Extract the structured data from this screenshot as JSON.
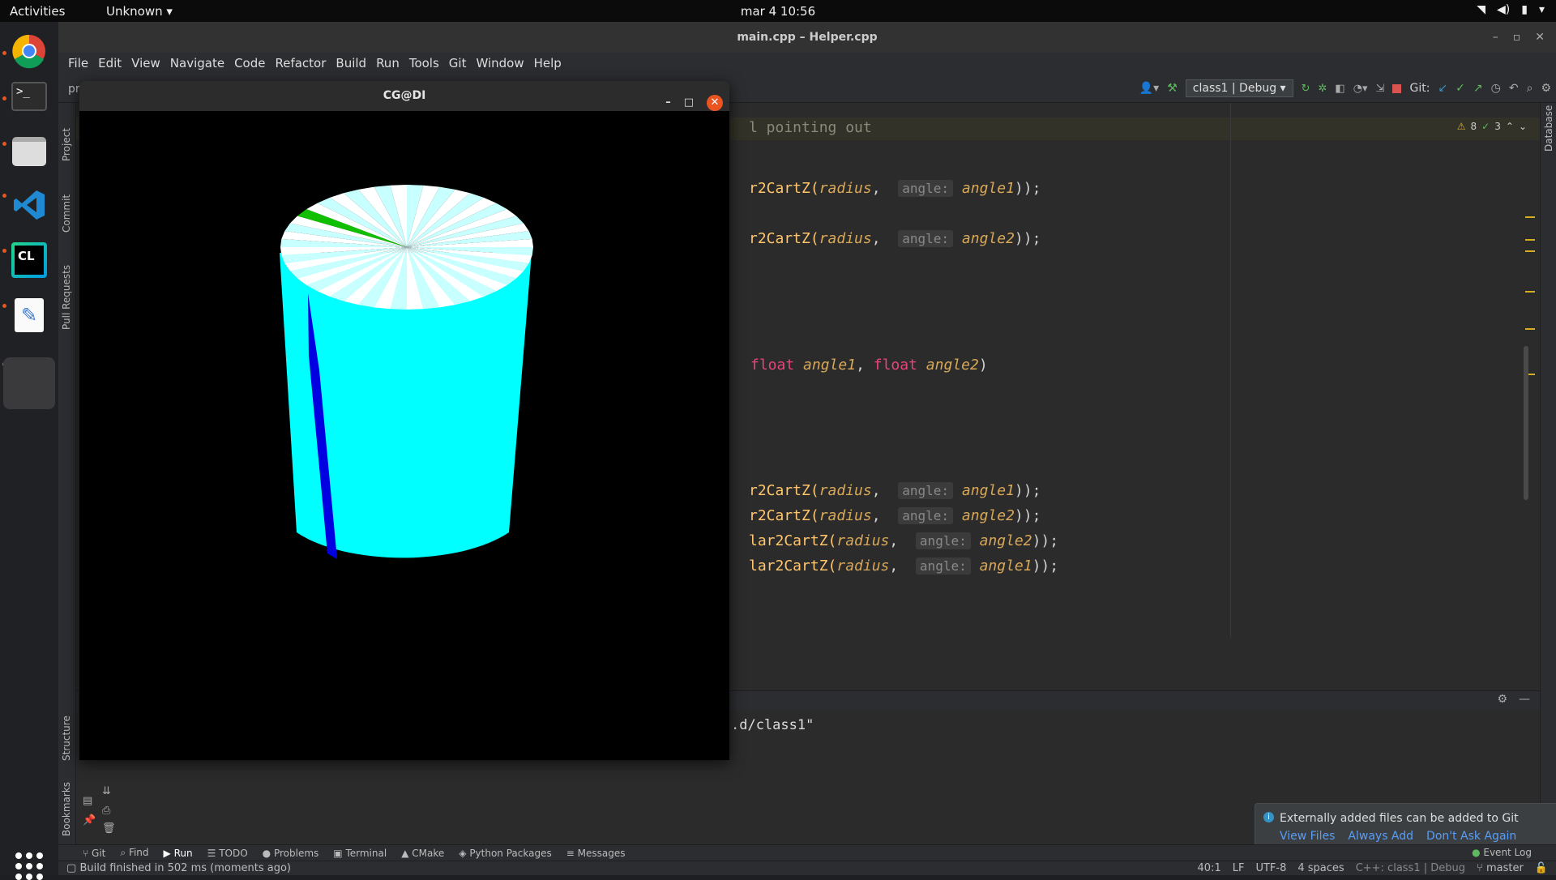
{
  "topbar": {
    "activities": "Activities",
    "app_menu": "Unknown",
    "clock": "mar 4  10:56"
  },
  "dock": {
    "items": [
      "chrome-icon",
      "terminal-icon",
      "files-icon",
      "vscode-icon",
      "clion-icon",
      "text-editor-icon",
      "running-app-icon"
    ]
  },
  "ide": {
    "title": "main.cpp – Helper.cpp",
    "menu": [
      "File",
      "Edit",
      "View",
      "Navigate",
      "Code",
      "Refactor",
      "Build",
      "Run",
      "Tools",
      "Git",
      "Window",
      "Help"
    ],
    "breadcrumb": "pr",
    "run_config": "class1 | Debug",
    "git_label": "Git:",
    "left_tools": [
      "Project",
      "Commit",
      "Pull Requests",
      "Structure",
      "Bookmarks"
    ],
    "right_tools": [
      "Database"
    ],
    "inspections": {
      "warnings": "8",
      "ok": "3"
    },
    "editor": {
      "line_comment": "l pointing out",
      "lines": [
        {
          "pre": "r2CartZ(",
          "arg": "radius",
          "hint": "angle:",
          "val": "angle1",
          "post": "));"
        },
        {
          "pre": "r2CartZ(",
          "arg": "radius",
          "hint": "angle:",
          "val": "angle2",
          "post": "));"
        },
        {
          "kw1": "float",
          "p1": "angle1",
          "kw2": "float",
          "p2": "angle2"
        },
        {
          "pre": "r2CartZ(",
          "arg": "radius",
          "hint": "angle:",
          "val": "angle1",
          "post": "));"
        },
        {
          "pre": "r2CartZ(",
          "arg": "radius",
          "hint": "angle:",
          "val": "angle2",
          "post": "));"
        },
        {
          "pre": "lar2CartZ(",
          "arg": "radius",
          "hint": "angle:",
          "val": "angle2",
          "post": "));"
        },
        {
          "pre": "lar2CartZ(",
          "arg": "radius",
          "hint": "angle:",
          "val": "angle1",
          "post": "));"
        }
      ]
    },
    "run_output": ".d/class1\"",
    "notification": {
      "message": "Externally added files can be added to Git",
      "actions": [
        "View Files",
        "Always Add",
        "Don't Ask Again"
      ]
    },
    "bottom_tools": [
      "Git",
      "Find",
      "Run",
      "TODO",
      "Problems",
      "Terminal",
      "CMake",
      "Python Packages",
      "Messages"
    ],
    "event_log": "Event Log",
    "status": {
      "message": "Build finished in 502 ms (moments ago)",
      "position": "40:1",
      "line_sep": "LF",
      "encoding": "UTF-8",
      "indent": "4 spaces",
      "context": "C++: class1 | Debug",
      "branch": "master"
    }
  },
  "gl_window": {
    "title": "CG@DI"
  },
  "colors": {
    "accent": "#e95420",
    "cylinder": "#00ffff",
    "stripe": "#0000e0",
    "highlight_slice": "#10c000"
  }
}
